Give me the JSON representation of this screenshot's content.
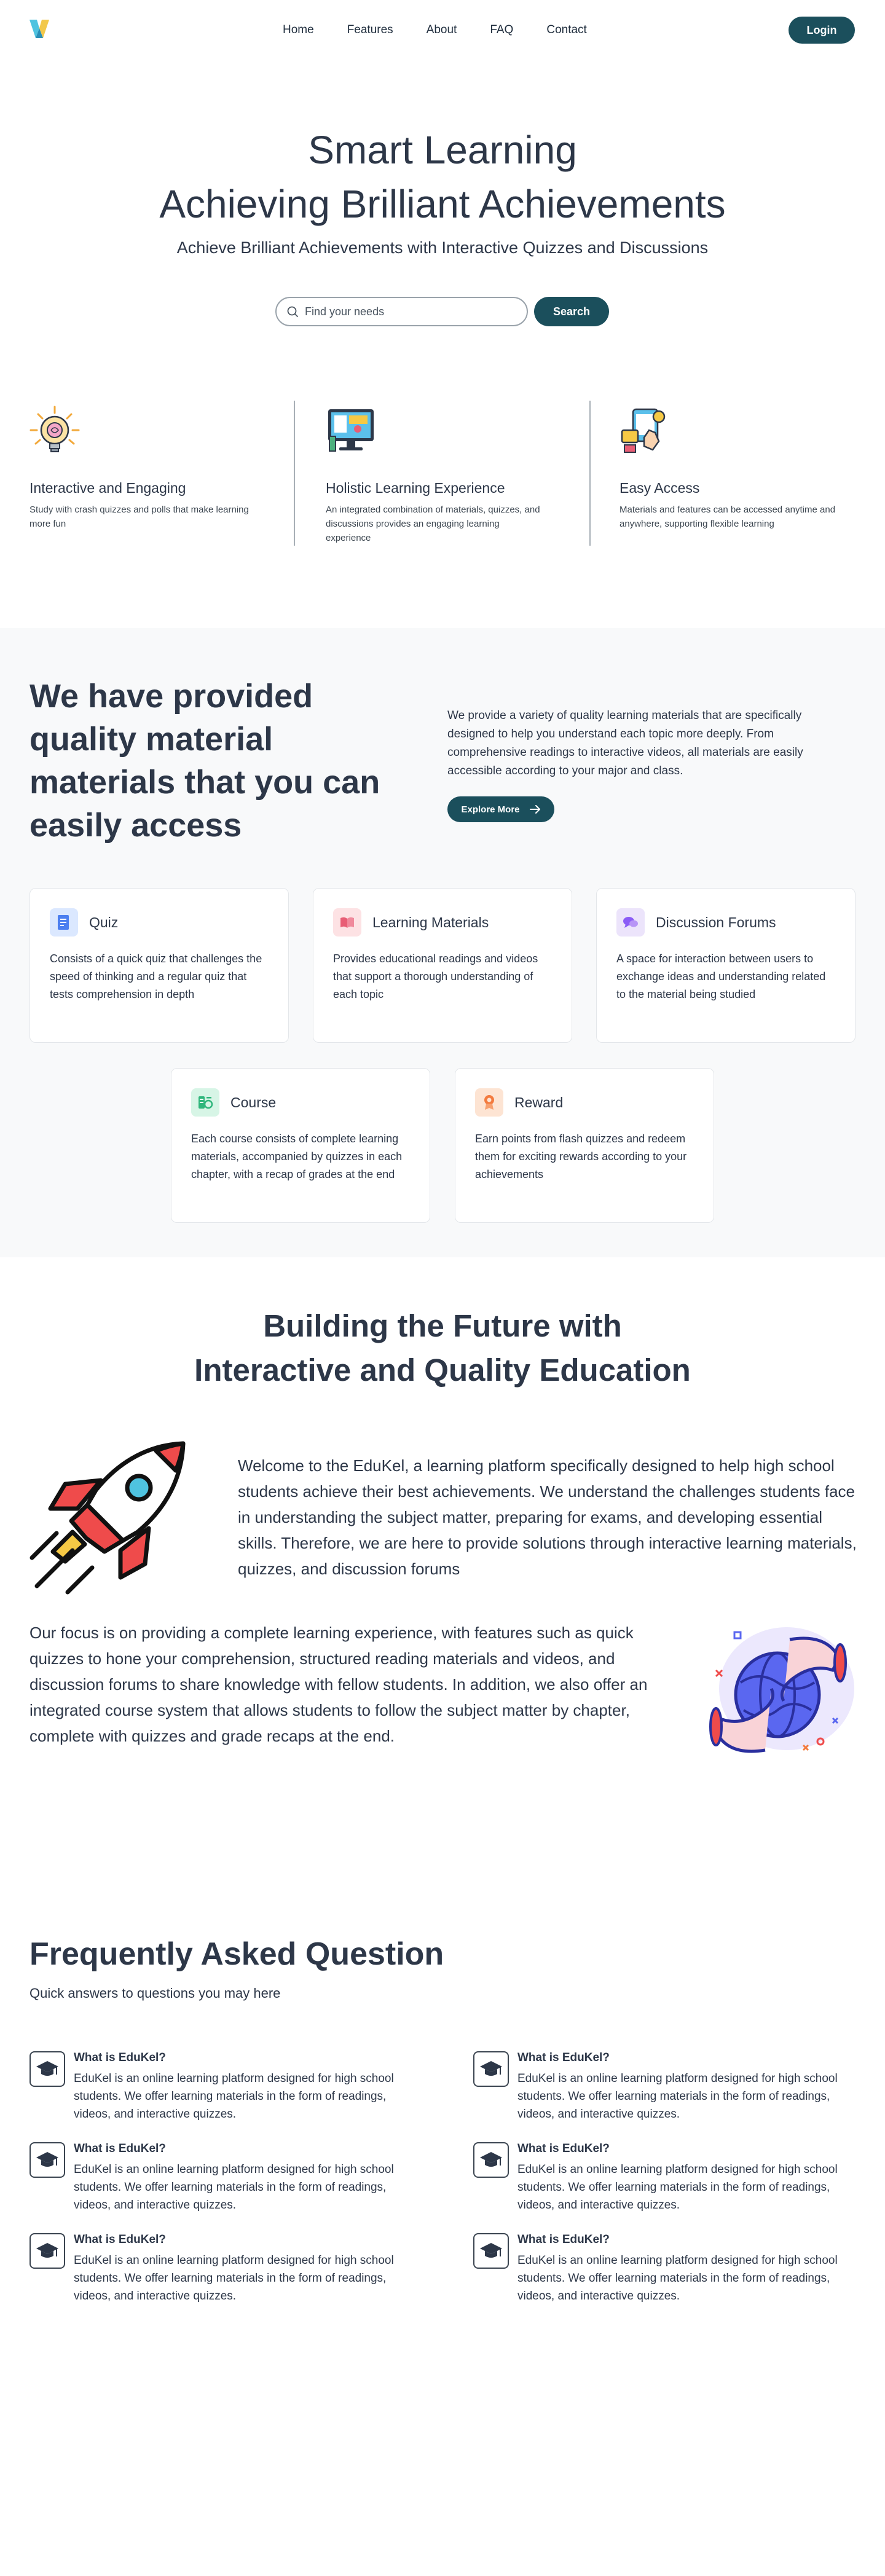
{
  "nav": {
    "logo_icon": "v-logo-icon",
    "links": [
      "Home",
      "Features",
      "About",
      "FAQ",
      "Contact"
    ],
    "login_label": "Login"
  },
  "hero": {
    "title_line1": "Smart Learning",
    "title_line2": "Achieving Brilliant Achievements",
    "subtitle": "Achieve Brilliant Achievements with Interactive Quizzes and Discussions",
    "search_placeholder": "Find your needs",
    "search_button": "Search"
  },
  "features": [
    {
      "icon": "lightbulb-brain-icon",
      "title": "Interactive and Engaging",
      "desc": "Study with crash quizzes and polls that make learning more fun"
    },
    {
      "icon": "monitor-learning-icon",
      "title": "Holistic Learning Experience",
      "desc": "An integrated combination of materials, quizzes, and discussions provides an engaging learning experience"
    },
    {
      "icon": "easy-access-icon",
      "title": "Easy Access",
      "desc": "Materials and features can be accessed anytime and anywhere, supporting flexible learning"
    }
  ],
  "materials": {
    "title": "We have provided quality material materials that you can easily access",
    "desc": "We provide a variety of quality learning materials that are specifically designed to help you understand each topic more deeply. From comprehensive readings to interactive videos, all materials are easily accessible according to your major and class.",
    "explore_label": "Explore More",
    "cards": [
      {
        "icon": "quiz-icon",
        "color": "#dbe8ff",
        "title": "Quiz",
        "desc": "Consists of a quick quiz that challenges the speed of thinking and a regular quiz that tests comprehension in depth"
      },
      {
        "icon": "book-icon",
        "color": "#fde2e4",
        "title": "Learning Materials",
        "desc": "Provides educational readings and videos that support a thorough understanding of each topic"
      },
      {
        "icon": "chat-icon",
        "color": "#ece4fb",
        "title": "Discussion Forums",
        "desc": "A space for interaction between users to exchange ideas and understanding related to the material being studied"
      },
      {
        "icon": "course-icon",
        "color": "#d7f5e6",
        "title": "Course",
        "desc": "Each course consists of complete learning materials, accompanied by quizzes in each chapter, with a recap of grades at the end"
      },
      {
        "icon": "reward-icon",
        "color": "#fde4d3",
        "title": "Reward",
        "desc": "Earn points from flash quizzes and redeem them for exciting rewards according to your achievements"
      }
    ]
  },
  "future": {
    "title_line1": "Building the Future with",
    "title_line2": "Interactive and Quality Education",
    "para1": "Welcome to the EduKel, a learning platform specifically designed to help high school students achieve their best achievements. We understand the challenges students face in understanding the subject matter, preparing for exams, and developing essential skills. Therefore, we are here to provide solutions through interactive learning materials, quizzes, and discussion forums",
    "para2": "Our focus is on providing a complete learning experience, with features such as quick quizzes to hone your comprehension, structured reading materials and videos, and discussion forums to share knowledge with fellow students. In addition, we also offer an integrated course system that allows students to follow the subject matter by chapter, complete with quizzes and grade recaps at the end."
  },
  "faq": {
    "title": "Frequently Asked Question",
    "subtitle": "Quick answers to questions you may here",
    "items": [
      {
        "q": "What is EduKel?",
        "a": "EduKel is an online learning platform designed for high school students. We offer learning materials in the form of readings, videos, and interactive quizzes."
      },
      {
        "q": "What is EduKel?",
        "a": "EduKel is an online learning platform designed for high school students. We offer learning materials in the form of readings, videos, and interactive quizzes."
      },
      {
        "q": "What is EduKel?",
        "a": "EduKel is an online learning platform designed for high school students. We offer learning materials in the form of readings, videos, and interactive quizzes."
      },
      {
        "q": "What is EduKel?",
        "a": "EduKel is an online learning platform designed for high school students. We offer learning materials in the form of readings, videos, and interactive quizzes."
      },
      {
        "q": "What is EduKel?",
        "a": "EduKel is an online learning platform designed for high school students. We offer learning materials in the form of readings, videos, and interactive quizzes."
      },
      {
        "q": "What is EduKel?",
        "a": "EduKel is an online learning platform designed for high school students. We offer learning materials in the form of readings, videos, and interactive quizzes."
      }
    ]
  },
  "colors": {
    "primary": "#1b4f5c",
    "text": "#2d3748",
    "section_bg": "#f8f9fa"
  }
}
